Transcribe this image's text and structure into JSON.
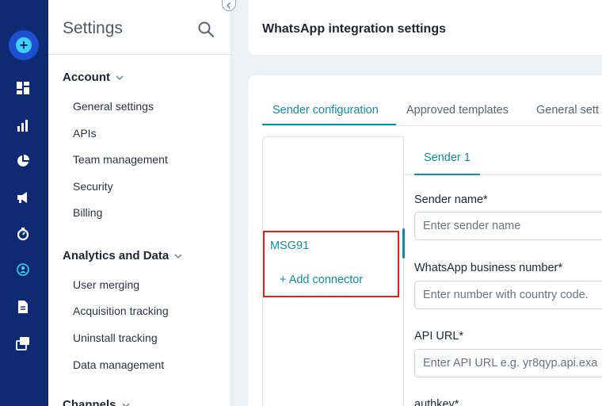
{
  "rail": {
    "icons": [
      "add-icon",
      "dashboard-icon",
      "bar-chart-icon",
      "pie-chart-icon",
      "megaphone-icon",
      "timer-icon",
      "target-user-icon",
      "document-icon",
      "windows-icon"
    ],
    "accent": "#3fd0ff",
    "background": "#0d2a73"
  },
  "settings": {
    "title": "Settings",
    "sections": [
      {
        "title": "Account",
        "items": [
          "General settings",
          "APIs",
          "Team management",
          "Security",
          "Billing"
        ]
      },
      {
        "title": "Analytics and Data",
        "items": [
          "User merging",
          "Acquisition tracking",
          "Uninstall tracking",
          "Data management"
        ]
      },
      {
        "title": "Channels",
        "items": []
      }
    ]
  },
  "header": {
    "title": "WhatsApp integration settings"
  },
  "tabs": [
    "Sender configuration",
    "Approved templates",
    "General sett"
  ],
  "connectors": {
    "items": [
      "MSG91"
    ],
    "add_label": "+ Add connector"
  },
  "sender": {
    "tab_label": "Sender 1",
    "fields": [
      {
        "label": "Sender name*",
        "placeholder": "Enter sender name"
      },
      {
        "label": "WhatsApp business number*",
        "placeholder": "Enter number with country code."
      },
      {
        "label": "API URL*",
        "placeholder": "Enter API URL e.g. yr8qyp.api.exa"
      },
      {
        "label": "authkey*",
        "placeholder": ""
      }
    ]
  },
  "colors": {
    "accent": "#0e8ea3",
    "highlight": "#e0201c"
  }
}
